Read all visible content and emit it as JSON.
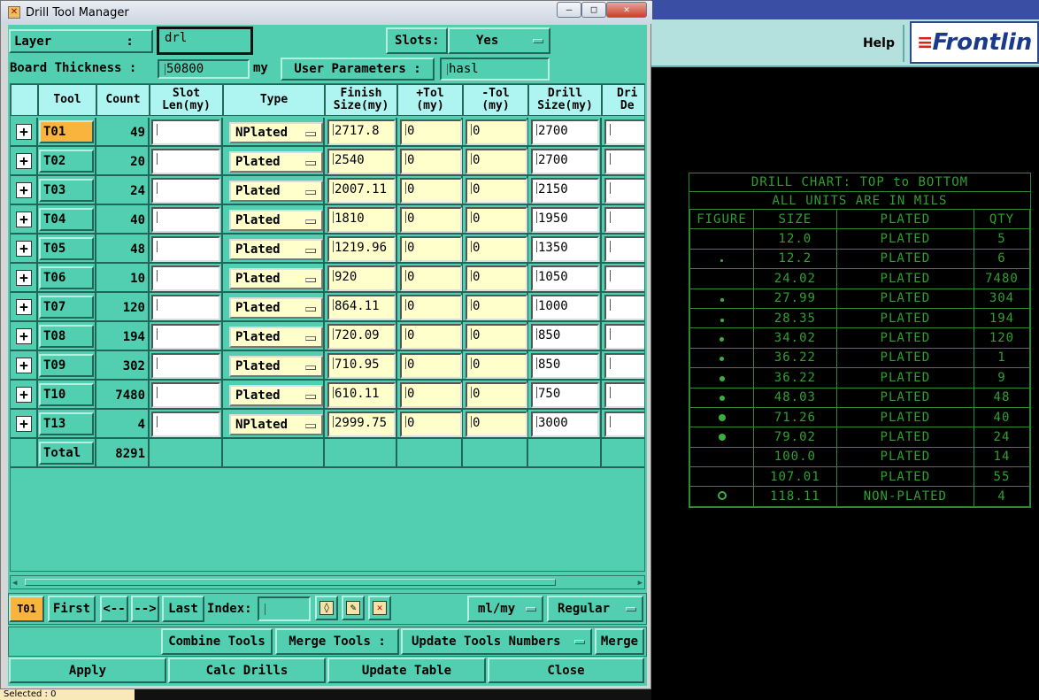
{
  "window": {
    "title": "Drill Tool Manager",
    "minimize": "—",
    "maximize": "□",
    "close": "✕"
  },
  "right_panel": {
    "help_label": "Help",
    "logo_text": "Frontlin"
  },
  "header": {
    "layer_label": "Layer          :",
    "layer_value": "drl",
    "slots_label": "Slots:",
    "slots_value": "Yes",
    "board_thickness_label": "Board Thickness :",
    "board_thickness_value": "50800",
    "board_thickness_unit": "my",
    "user_params_label": "User Parameters :",
    "user_params_value": "hasl"
  },
  "table": {
    "columns": [
      "Tool",
      "Count",
      "Slot\nLen(my)",
      "Type",
      "Finish\nSize(my)",
      "+Tol\n(my)",
      "-Tol\n(my)",
      "Drill\nSize(my)",
      "Dri\nDe"
    ],
    "rows": [
      {
        "tag": "A",
        "tool": "T01",
        "count": "49",
        "type": "NPlated",
        "finish": "2717.8",
        "ptol": "0",
        "ntol": "0",
        "drill": "2700"
      },
      {
        "tag": "B",
        "tool": "T02",
        "count": "20",
        "type": "Plated",
        "finish": "2540",
        "ptol": "0",
        "ntol": "0",
        "drill": "2700"
      },
      {
        "tag": "C",
        "tool": "T03",
        "count": "24",
        "type": "Plated",
        "finish": "2007.11",
        "ptol": "0",
        "ntol": "0",
        "drill": "2150"
      },
      {
        "tag": "D",
        "tool": "T04",
        "count": "40",
        "type": "Plated",
        "finish": "1810",
        "ptol": "0",
        "ntol": "0",
        "drill": "1950"
      },
      {
        "tag": "E",
        "tool": "T05",
        "count": "48",
        "type": "Plated",
        "finish": "1219.96",
        "ptol": "0",
        "ntol": "0",
        "drill": "1350"
      },
      {
        "tag": "F",
        "tool": "T06",
        "count": "10",
        "type": "Plated",
        "finish": "920",
        "ptol": "0",
        "ntol": "0",
        "drill": "1050"
      },
      {
        "tag": "G",
        "tool": "T07",
        "count": "120",
        "type": "Plated",
        "finish": "864.11",
        "ptol": "0",
        "ntol": "0",
        "drill": "1000"
      },
      {
        "tag": "H",
        "tool": "T08",
        "count": "194",
        "type": "Plated",
        "finish": "720.09",
        "ptol": "0",
        "ntol": "0",
        "drill": "850"
      },
      {
        "tag": "I",
        "tool": "T09",
        "count": "302",
        "type": "Plated",
        "finish": "710.95",
        "ptol": "0",
        "ntol": "0",
        "drill": "850"
      },
      {
        "tag": "J",
        "tool": "T10",
        "count": "7480",
        "type": "Plated",
        "finish": "610.11",
        "ptol": "0",
        "ntol": "0",
        "drill": "750"
      },
      {
        "tag": "M",
        "tool": "T13",
        "count": "4",
        "type": "NPlated",
        "finish": "2999.75",
        "ptol": "0",
        "ntol": "0",
        "drill": "3000"
      }
    ],
    "total_label": "Total",
    "total_count": "8291"
  },
  "navigation": {
    "current_tool": "T01",
    "first": "First",
    "prev": "<--",
    "next": "-->",
    "last": "Last",
    "index_label": "Index:",
    "index_value": "",
    "units_value": "ml/my",
    "mode_value": "Regular"
  },
  "actions": {
    "combine_tools": "Combine Tools",
    "merge_tools_label": "Merge Tools :",
    "merge_mode": "Update Tools Numbers",
    "merge": "Merge",
    "apply": "Apply",
    "calc_drills": "Calc Drills",
    "update_table": "Update Table",
    "close": "Close"
  },
  "status": {
    "selected": "Selected : 0"
  },
  "drill_chart": {
    "title": "DRILL CHART: TOP to BOTTOM",
    "subtitle": "ALL UNITS ARE IN MILS",
    "headers": [
      "FIGURE",
      "SIZE",
      "PLATED",
      "QTY"
    ],
    "rows": [
      {
        "size": "12.0",
        "plated": "PLATED",
        "qty": "5",
        "fig": 0
      },
      {
        "size": "12.2",
        "plated": "PLATED",
        "qty": "6",
        "fig": 3
      },
      {
        "size": "24.02",
        "plated": "PLATED",
        "qty": "7480",
        "fig": 0
      },
      {
        "size": "27.99",
        "plated": "PLATED",
        "qty": "304",
        "fig": 4
      },
      {
        "size": "28.35",
        "plated": "PLATED",
        "qty": "194",
        "fig": 4
      },
      {
        "size": "34.02",
        "plated": "PLATED",
        "qty": "120",
        "fig": 5
      },
      {
        "size": "36.22",
        "plated": "PLATED",
        "qty": "1",
        "fig": 5
      },
      {
        "size": "36.22",
        "plated": "PLATED",
        "qty": "9",
        "fig": 6
      },
      {
        "size": "48.03",
        "plated": "PLATED",
        "qty": "48",
        "fig": 6
      },
      {
        "size": "71.26",
        "plated": "PLATED",
        "qty": "40",
        "fig": 8
      },
      {
        "size": "79.02",
        "plated": "PLATED",
        "qty": "24",
        "fig": 8
      },
      {
        "size": "100.0",
        "plated": "PLATED",
        "qty": "14",
        "fig": 0
      },
      {
        "size": "107.01",
        "plated": "PLATED",
        "qty": "55",
        "fig": 0
      },
      {
        "size": "118.11",
        "plated": "NON-PLATED",
        "qty": "4",
        "fig": 10
      }
    ]
  },
  "colors": {
    "panel": "#52cfb0",
    "header": "#aef5f2",
    "selected": "#f8b43c",
    "chart": "#2fa02f"
  }
}
